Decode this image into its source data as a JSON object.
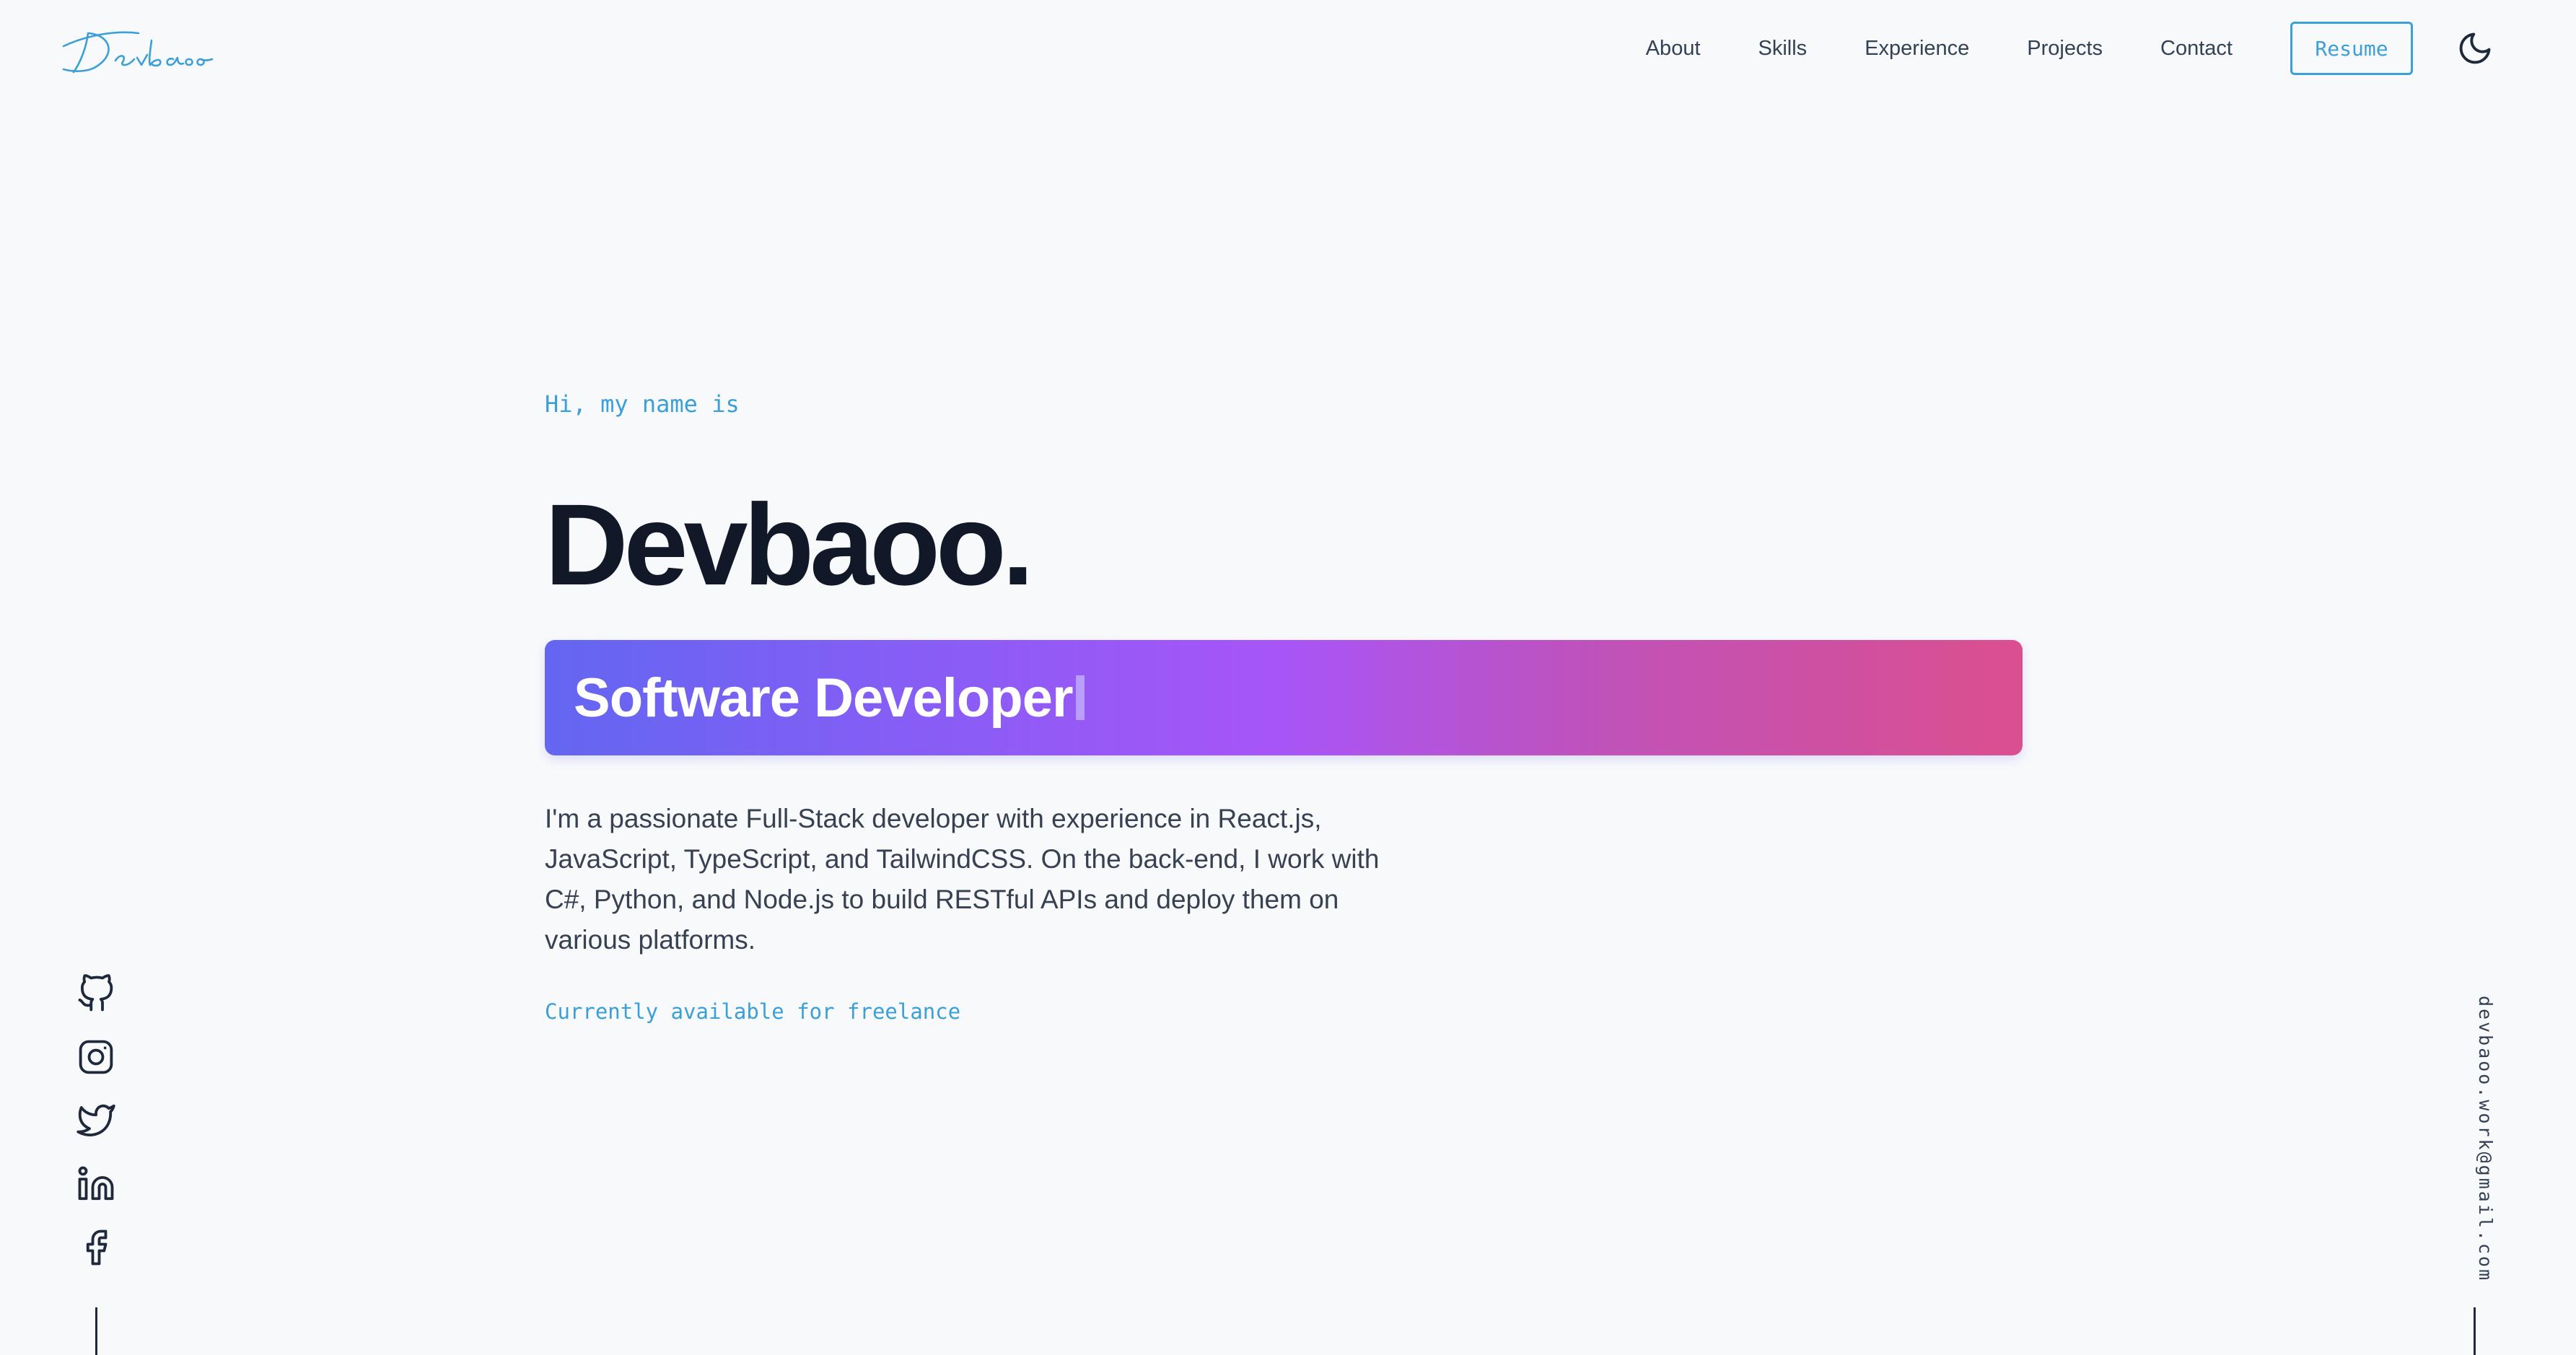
{
  "brand": {
    "logo_text": "Devbaoo",
    "accent_color": "#3b9fd8"
  },
  "nav": {
    "items": [
      {
        "label": "About"
      },
      {
        "label": "Skills"
      },
      {
        "label": "Experience"
      },
      {
        "label": "Projects"
      },
      {
        "label": "Contact"
      }
    ],
    "resume_label": "Resume",
    "theme_icon": "moon-icon"
  },
  "hero": {
    "greeting": "Hi, my name is",
    "name": "Devbaoo.",
    "role": "Software Developer",
    "intro": "I'm a passionate Full-Stack developer with experience in React.js, JavaScript, TypeScript, and TailwindCSS. On the back-end, I work with C#, Python, and Node.js to build RESTful APIs and deploy them on various platforms.",
    "availability": "Currently available for freelance",
    "banner_gradient": [
      "#6366f1",
      "#8b5cf6",
      "#a855f7",
      "#c052b8",
      "#db4f8f"
    ]
  },
  "social": {
    "icons": [
      "github-icon",
      "instagram-icon",
      "twitter-icon",
      "linkedin-icon",
      "facebook-icon"
    ]
  },
  "contact": {
    "email": "devbaoo.work@gmail.com"
  }
}
